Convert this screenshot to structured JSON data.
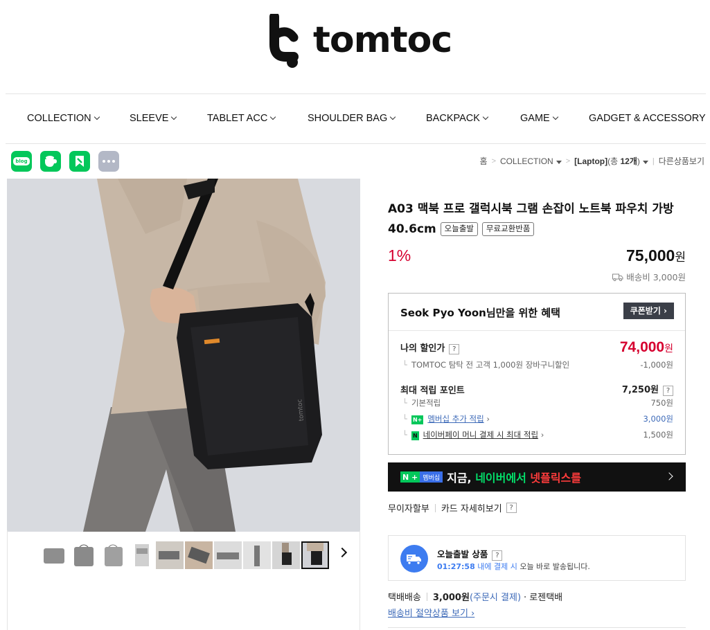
{
  "brand": {
    "name": "tomtoc"
  },
  "nav": {
    "items": [
      {
        "label": "COLLECTION"
      },
      {
        "label": "SLEEVE"
      },
      {
        "label": "TABLET ACC"
      },
      {
        "label": "SHOULDER BAG"
      },
      {
        "label": "BACKPACK"
      },
      {
        "label": "GAME"
      },
      {
        "label": "GADGET & ACCESSORY"
      }
    ]
  },
  "share": {
    "blog_label": "blog"
  },
  "breadcrumb": {
    "home": "홈",
    "collection": "COLLECTION",
    "category": "[Laptop]",
    "count_prefix": "(총 ",
    "count": "12개",
    "count_suffix": ")",
    "other": "다른상품보기"
  },
  "product": {
    "title": "A03 맥북 프로 갤럭시북 그램 손잡이 노트북 파우치 가방 40.6cm",
    "tags": [
      "오늘출발",
      "무료교환반품"
    ],
    "discount": "1%",
    "price": "75,000",
    "price_unit": "원",
    "shipping_fee": "배송비 3,000원"
  },
  "benefit": {
    "user": "Seok Pyo Yoon",
    "title_suffix": "님만을 위한 혜택",
    "coupon_button": "쿠폰받기",
    "my_price_label": "나의 할인가",
    "my_price": "74,000",
    "my_price_unit": "원",
    "discount_detail": "TOMTOC 탐탁 전 고객 1,000원 장바구니할인",
    "discount_amount": "-1,000원",
    "points_label": "최대 적립 포인트",
    "points_value": "7,250원",
    "basic_label": "기본적립",
    "basic_value": "750원",
    "membership_badge": "N+",
    "membership_label": "멤버십 추가 적립",
    "membership_value": "3,000원",
    "npay_badge": "N",
    "npay_label": "네이버페이 머니 결제 시 최대 적립",
    "npay_value": "1,500원",
    "help": "?"
  },
  "promo": {
    "badge": "N +",
    "badge2": "멤버십",
    "text_a": "지금, ",
    "text_b": "네이버에서 ",
    "text_c": "넷플릭스를"
  },
  "installment": {
    "label": "무이자할부",
    "card_link": "카드 자세히보기",
    "help": "?"
  },
  "today": {
    "title": "오늘출발 상품",
    "help": "?",
    "timer": "01:27:58",
    "within": " 내에 결제 시",
    "rest": " 오늘 바로 발송됩니다."
  },
  "delivery": {
    "method": "택배배송",
    "fee": "3,000원",
    "timing": "(주문시 결제)",
    "courier": "· 로젠택배",
    "save_link": "배송비 절약상품 보기"
  },
  "colors": {
    "accent_red": "#d6002f",
    "naver_green": "#03c75a",
    "link_blue": "#3d6ab8",
    "dark_button": "#3b3f48"
  }
}
